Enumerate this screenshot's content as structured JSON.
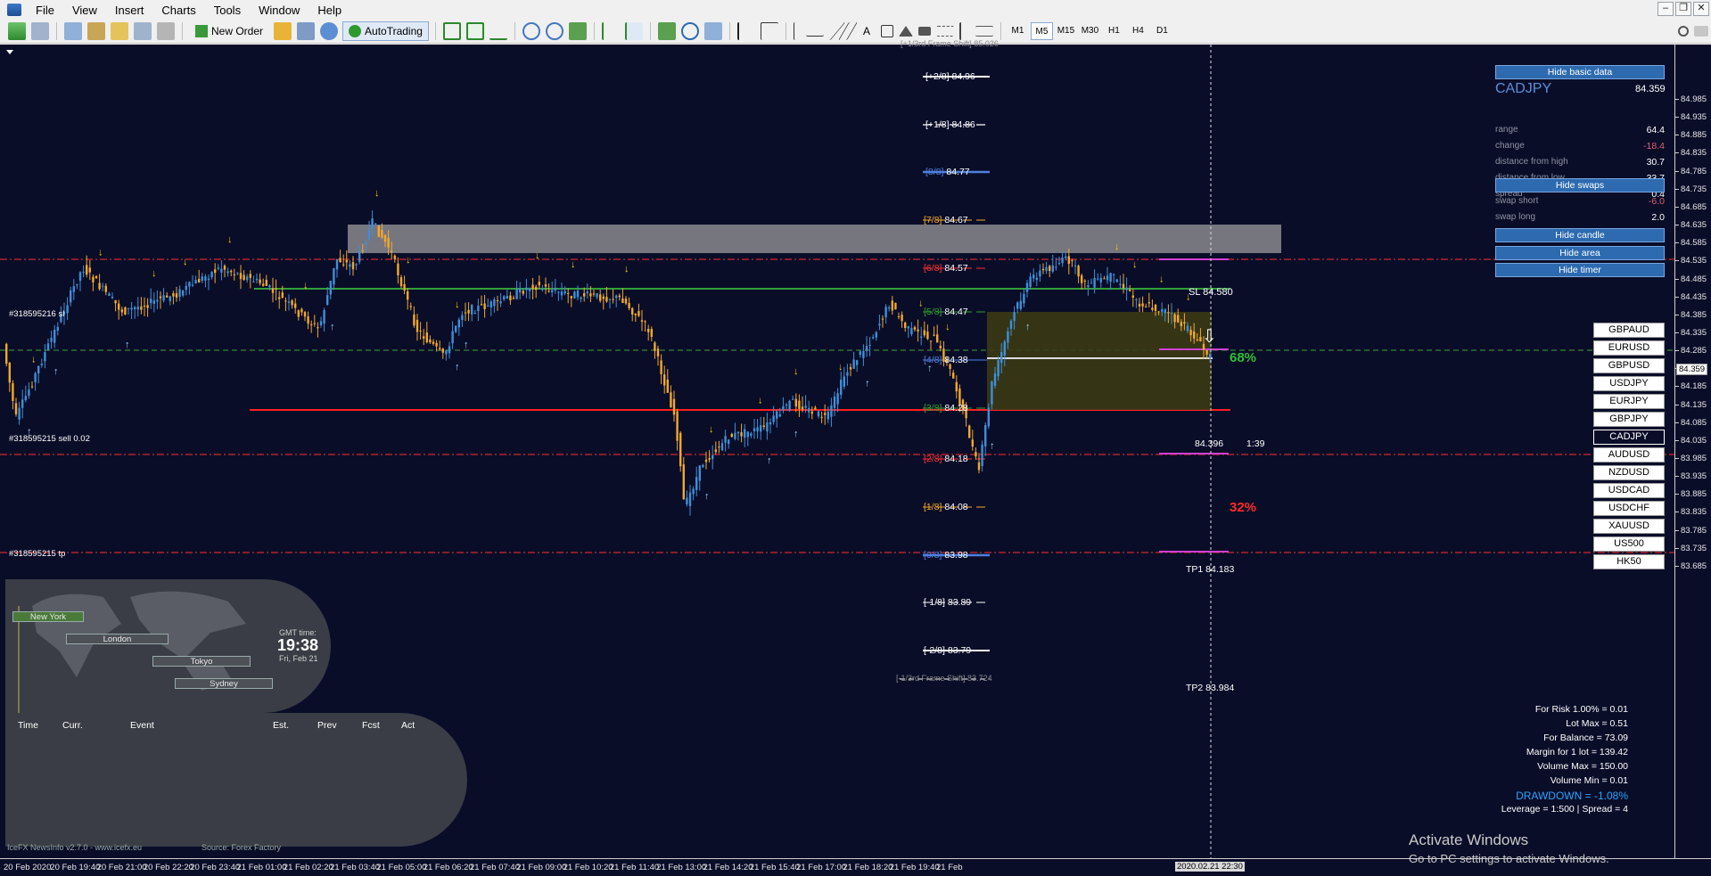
{
  "menu": [
    "File",
    "View",
    "Insert",
    "Charts",
    "Tools",
    "Window",
    "Help"
  ],
  "toolbar": {
    "new_order": "New Order",
    "auto_trading": "AutoTrading",
    "timeframes": [
      "M1",
      "M5",
      "M15",
      "M30",
      "H1",
      "H4",
      "D1"
    ],
    "active_timeframe": "M5"
  },
  "murrey": [
    {
      "label": "[+1/3rd Frame Shift]",
      "value": "85.026"
    },
    {
      "label": "[+2/8]",
      "value": "84.96"
    },
    {
      "label": "[+1/8]",
      "value": "84.86"
    },
    {
      "label": "[8/8]",
      "value": "84.77"
    },
    {
      "label": "[7/8]",
      "value": "84.67"
    },
    {
      "label": "[6/8]",
      "value": "84.57"
    },
    {
      "label": "[5/8]",
      "value": "84.47"
    },
    {
      "label": "[4/8]",
      "value": "84.38"
    },
    {
      "label": "[3/8]",
      "value": "84.28"
    },
    {
      "label": "[2/8]",
      "value": "84.18"
    },
    {
      "label": "[1/8]",
      "value": "84.08"
    },
    {
      "label": "[0/8]",
      "value": "83.98"
    },
    {
      "label": "[-1/8]",
      "value": "83.89"
    },
    {
      "label": "[-2/8]",
      "value": "83.79"
    },
    {
      "label": "[-1/3rd Frame Shift]",
      "value": "83.724"
    }
  ],
  "trade": {
    "sl_label": "SL 84.580",
    "sl_order": "#318595216 sl",
    "sell_order": "#318595215 sell 0.02",
    "tp_order": "#318595215 tp",
    "tp1": "TP1 84.183",
    "tp2": "TP2 83.984",
    "pct_up": "68%",
    "pct_down": "32%",
    "price_tag": "84.396",
    "ratio": "1:39"
  },
  "panel": {
    "hide_basic": "Hide basic data",
    "symbol": "CADJPY",
    "price": "84.359",
    "rows": [
      {
        "k": "range",
        "v": "64.4",
        "neg": false
      },
      {
        "k": "change",
        "v": "-18.4",
        "neg": true
      },
      {
        "k": "distance from high",
        "v": "30.7",
        "neg": false
      },
      {
        "k": "distance from low",
        "v": "33.7",
        "neg": false
      },
      {
        "k": "spread",
        "v": "0.4",
        "neg": false
      }
    ],
    "hide_swaps": "Hide swaps",
    "swaps": [
      {
        "k": "swap short",
        "v": "-6.0",
        "neg": true
      },
      {
        "k": "swap long",
        "v": "2.0",
        "neg": false
      }
    ],
    "hide_candle": "Hide candle",
    "hide_area": "Hide area",
    "hide_timer": "Hide timer"
  },
  "symbols": [
    "GBPAUD",
    "EURUSD",
    "GBPUSD",
    "USDJPY",
    "EURJPY",
    "GBPJPY",
    "CADJPY",
    "AUDUSD",
    "NZDUSD",
    "USDCAD",
    "USDCHF",
    "XAUUSD",
    "US500",
    "HK50"
  ],
  "active_symbol": "CADJPY",
  "risk": [
    "For Risk 1.00% = 0.01",
    "Lot Max = 0.51",
    "For Balance = 73.09",
    "Margin for 1 lot = 139.42",
    "Volume Max = 150.00",
    "Volume Min = 0.01",
    "DRAWDOWN = -1.08%",
    "Leverage = 1:500 | Spread = 4"
  ],
  "world": {
    "gmt_label": "GMT time:",
    "time": "19:38",
    "date": "Fri, Feb 21",
    "sessions": [
      "New York",
      "London",
      "Tokyo",
      "Sydney"
    ]
  },
  "news": {
    "headers": [
      "Time",
      "Curr.",
      "Event",
      "Est.",
      "Prev",
      "Fcst",
      "Act"
    ],
    "footer": "IceFX NewsInfo v2.7.0  -  www.icefx.eu",
    "source": "Source: Forex Factory"
  },
  "price_axis": [
    "84.985",
    "84.935",
    "84.885",
    "84.835",
    "84.785",
    "84.735",
    "84.685",
    "84.635",
    "84.585",
    "84.535",
    "84.485",
    "84.435",
    "84.385",
    "84.335",
    "84.285",
    "84.235",
    "84.185",
    "84.135",
    "84.085",
    "84.035",
    "83.985",
    "83.935",
    "83.885",
    "83.835",
    "83.785",
    "83.735",
    "83.685"
  ],
  "current_price": "84.359",
  "time_axis": [
    "20 Feb 2020",
    "20 Feb 19:40",
    "20 Feb 21:00",
    "20 Feb 22:20",
    "20 Feb 23:40",
    "21 Feb 01:00",
    "21 Feb 02:20",
    "21 Feb 03:40",
    "21 Feb 05:00",
    "21 Feb 06:20",
    "21 Feb 07:40",
    "21 Feb 09:00",
    "21 Feb 10:20",
    "21 Feb 11:40",
    "21 Feb 13:00",
    "21 Feb 14:20",
    "21 Feb 15:40",
    "21 Feb 17:00",
    "21 Feb 18:20",
    "21 Feb 19:40",
    "21 Feb"
  ],
  "time_cursor": "2020.02.21 22:30",
  "watermark": {
    "line1": "Activate Windows",
    "line2": "Go to PC settings to activate Windows."
  },
  "colors": {
    "background": "#0a0d28",
    "bull": "#3f8fd8",
    "bear": "#f2a82e",
    "sl": "#ff3030",
    "entry": "#00c000",
    "tp": "#d040d0",
    "panel_btn": "#2d6ab0"
  }
}
